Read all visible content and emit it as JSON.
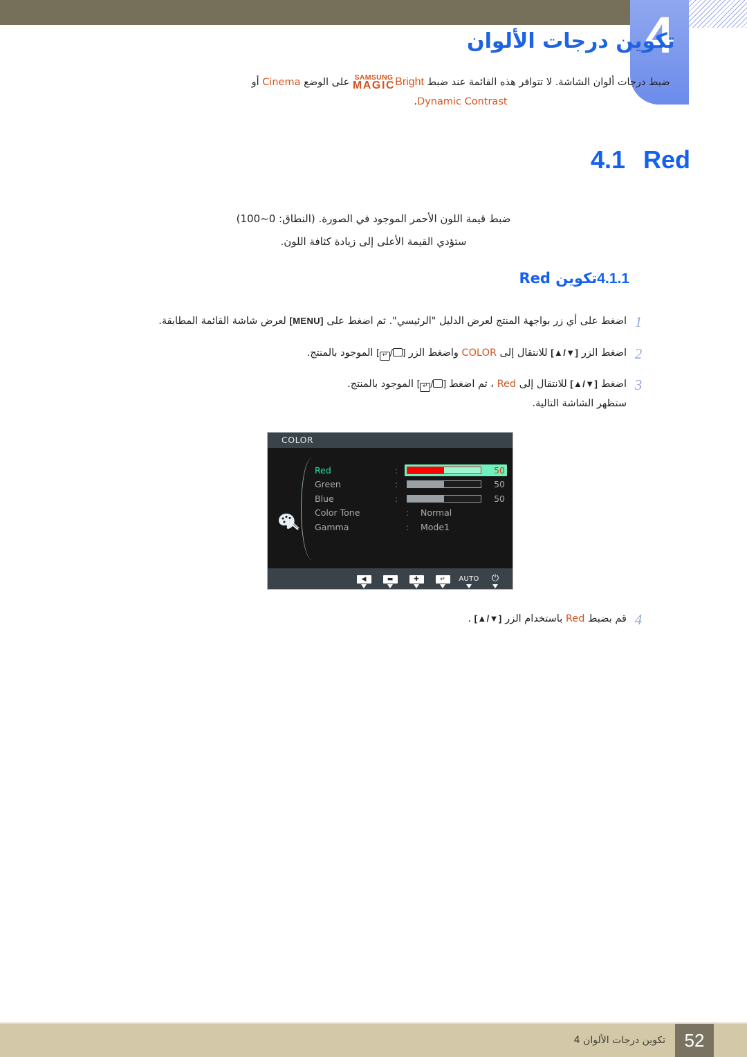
{
  "chapter": {
    "number": "4",
    "title": "تكوين درجات الألوان",
    "description_part1": "ضبط درجات ألوان الشاشة. لا تتوافر هذه القائمة عند ضبط",
    "magic_line1": "SAMSUNG",
    "magic_line2": "MAGIC",
    "magic_bright": "Bright",
    "description_part2": "على الوضع",
    "mode_cinema": "Cinema",
    "description_part3": "أو",
    "mode_dynamic": "Dynamic Contrast",
    "description_end": "."
  },
  "section": {
    "number": "4.1",
    "title": "Red",
    "desc_line1": "ضبط قيمة اللون الأحمر الموجود في الصورة. (النطاق: 0~100)",
    "desc_line2": "ستؤدي القيمة الأعلى إلى زيادة كثافة اللون."
  },
  "subsection": {
    "number": "4.1.1",
    "title_ar": "تكوين",
    "title_en": "Red"
  },
  "steps": [
    {
      "num": "1",
      "text_a": "اضغط على أي زر بواجهة المنتج لعرض الدليل \"الرئيسي\". ثم اضغط على",
      "kbd": "[MENU]",
      "text_b": "لعرض شاشة القائمة المطابقة."
    },
    {
      "num": "2",
      "text_a": "اضغط الزر",
      "kbd1": "[▲/▼]",
      "text_b": "للانتقال إلى",
      "target": "COLOR",
      "text_c": "واضغط الزر",
      "kbd2_enter": "↵",
      "text_d": "الموجود بالمنتج."
    },
    {
      "num": "3",
      "text_a": "اضغط",
      "kbd1": "[▲/▼]",
      "text_b": "للانتقال إلى",
      "target": "Red",
      "text_c": "، ثم اضغط",
      "kbd2_enter": "↵",
      "text_d": "الموجود بالمنتج.",
      "text_e": "ستظهر الشاشة التالية."
    },
    {
      "num": "4",
      "text_a": "قم بضبط",
      "target": "Red",
      "text_b": "باستخدام الزر",
      "kbd1": "[▲/▼]",
      "text_c": "."
    }
  ],
  "osd": {
    "title": "COLOR",
    "rows": [
      {
        "label": "Red",
        "type": "slider",
        "value": "50",
        "percent": 50,
        "active": true
      },
      {
        "label": "Green",
        "type": "slider",
        "value": "50",
        "percent": 50,
        "active": false
      },
      {
        "label": "Blue",
        "type": "slider",
        "value": "50",
        "percent": 50,
        "active": false
      },
      {
        "label": "Color Tone",
        "type": "text",
        "value": "Normal",
        "active": false
      },
      {
        "label": "Gamma",
        "type": "text",
        "value": "Mode1",
        "active": false
      }
    ],
    "footer_buttons": [
      {
        "name": "back",
        "glyph": "◀"
      },
      {
        "name": "minus",
        "glyph": "▬"
      },
      {
        "name": "plus",
        "glyph": "✚"
      },
      {
        "name": "enter",
        "glyph": "↵"
      },
      {
        "name": "auto",
        "glyph": "AUTO"
      },
      {
        "name": "power",
        "glyph": "⏻"
      }
    ],
    "colors": {
      "highlight": "#6ef1be",
      "bar_fill_active": "#ff0000",
      "value_active": "#e03a00",
      "panel_bg": "#161616",
      "titlebar_bg": "#3a4349"
    }
  },
  "footer": {
    "page": "52",
    "text": "تكوين درجات الألوان 4"
  },
  "colors": {
    "heading_blue": "#1560f0",
    "accent_orange": "#d4541f",
    "top_band": "#76705b",
    "footer_band": "#d3c8a8",
    "tab_blue": "#6c8cec"
  }
}
